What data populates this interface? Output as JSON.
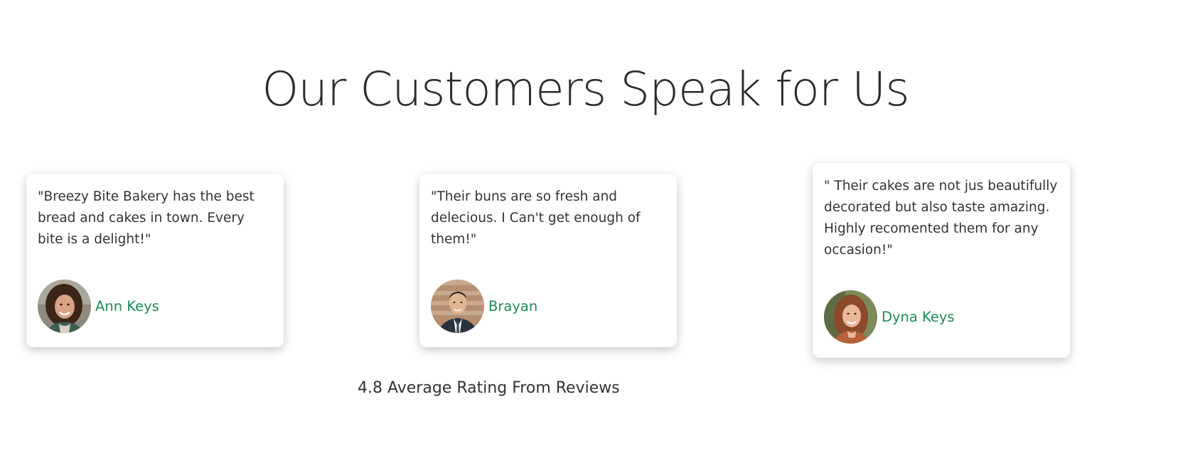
{
  "section": {
    "title": "Our Customers Speak for Us"
  },
  "testimonials": [
    {
      "quote": "\"Breezy Bite Bakery has the best bread and cakes in town. Every bite is a delight!\"",
      "name": "Ann Keys",
      "avatar_icon": "woman-portrait-photo"
    },
    {
      "quote": "\"Their buns are so fresh and delecious. I Can't get enough of them!\"",
      "name": "Brayan",
      "avatar_icon": "man-portrait-photo"
    },
    {
      "quote": "\" Their cakes are not jus beautifully decorated but also taste amazing. Highly recomented them for any occasion!\"",
      "name": "Dyna Keys",
      "avatar_icon": "woman-portrait-photo"
    }
  ],
  "rating": {
    "text": "4.8 Average Rating From Reviews"
  },
  "colors": {
    "accent": "#1f8a55",
    "text": "#333333",
    "background": "#ffffff"
  }
}
